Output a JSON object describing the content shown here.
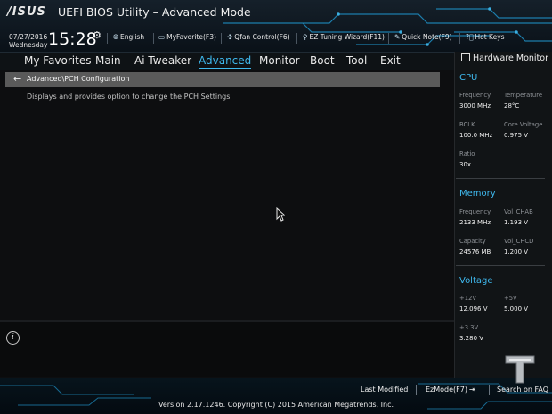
{
  "header": {
    "logo": "/ISUS",
    "title": "UEFI BIOS Utility – Advanced Mode",
    "date": "07/27/2016",
    "weekday": "Wednesday",
    "time": "15:28",
    "buttons": [
      {
        "label": "English",
        "icon": "globe-icon"
      },
      {
        "label": "MyFavorite(F3)",
        "icon": "favorite-icon"
      },
      {
        "label": "Qfan Control(F6)",
        "icon": "fan-icon"
      },
      {
        "label": "EZ Tuning Wizard(F11)",
        "icon": "wizard-icon"
      },
      {
        "label": "Quick Note(F9)",
        "icon": "note-icon"
      },
      {
        "label": "Hot Keys",
        "icon": "help-icon"
      }
    ]
  },
  "tabs": [
    {
      "label": "My Favorites"
    },
    {
      "label": "Main"
    },
    {
      "label": "Ai Tweaker"
    },
    {
      "label": "Advanced",
      "active": true
    },
    {
      "label": "Monitor"
    },
    {
      "label": "Boot"
    },
    {
      "label": "Tool"
    },
    {
      "label": "Exit"
    }
  ],
  "main": {
    "breadcrumb": "Advanced\\PCH Configuration",
    "description": "Displays and provides option to change the PCH Settings"
  },
  "hardware_monitor": {
    "title": "Hardware Monitor",
    "cpu": {
      "heading": "CPU",
      "frequency_label": "Frequency",
      "frequency": "3000 MHz",
      "temperature_label": "Temperature",
      "temperature": "28°C",
      "bclk_label": "BCLK",
      "bclk": "100.0 MHz",
      "core_voltage_label": "Core Voltage",
      "core_voltage": "0.975 V",
      "ratio_label": "Ratio",
      "ratio": "30x"
    },
    "memory": {
      "heading": "Memory",
      "frequency_label": "Frequency",
      "frequency": "2133 MHz",
      "vol_chab_label": "Vol_CHAB",
      "vol_chab": "1.193 V",
      "capacity_label": "Capacity",
      "capacity": "24576 MB",
      "vol_chcd_label": "Vol_CHCD",
      "vol_chcd": "1.200 V"
    },
    "voltage": {
      "heading": "Voltage",
      "v12_label": "+12V",
      "v12": "12.096 V",
      "v5_label": "+5V",
      "v5": "5.000 V",
      "v33_label": "+3.3V",
      "v33": "3.280 V"
    }
  },
  "footer": {
    "last_modified": "Last Modified",
    "ezmode": "EzMode(F7)",
    "search": "Search on FAQ",
    "version": "Version 2.17.1246. Copyright (C) 2015 American Megatrends, Inc."
  },
  "colors": {
    "accent": "#3fb9ee",
    "background": "#0d0e10",
    "breadcrumb_bar": "#5a5a5a"
  }
}
